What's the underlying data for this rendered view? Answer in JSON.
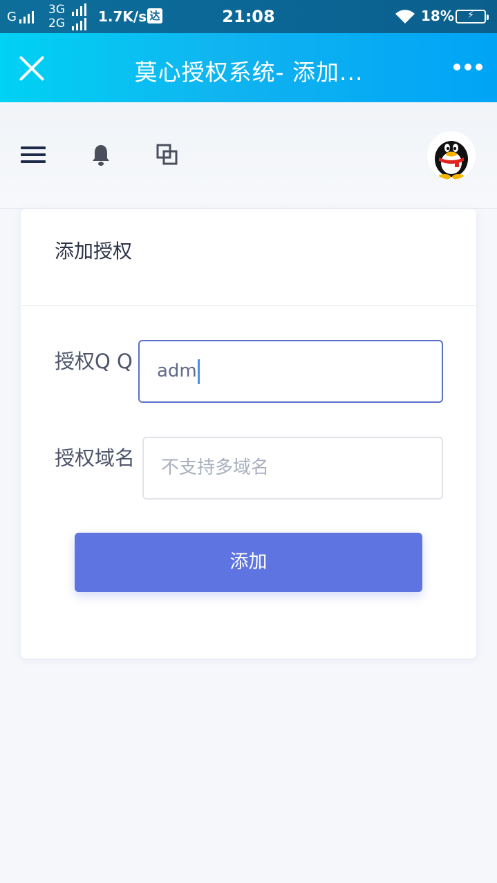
{
  "status_bar": {
    "carrier_g": "G",
    "net_top": "3G",
    "net_bottom": "2G",
    "speed": "1.7K/s",
    "app_badge": "达",
    "time": "21:08",
    "battery": "18%"
  },
  "title_bar": {
    "title": "莫心授权系统- 添加..."
  },
  "card": {
    "title": "添加授权",
    "qq_label": "授权Q Q",
    "qq_value": "adm",
    "domain_label": "授权域名",
    "domain_placeholder": "不支持多域名",
    "submit_label": "添加"
  },
  "colors": {
    "titlebar_start": "#00d2f4",
    "titlebar_end": "#00a4f6",
    "button": "#5e74e0",
    "focus_border": "#5a70cc"
  }
}
